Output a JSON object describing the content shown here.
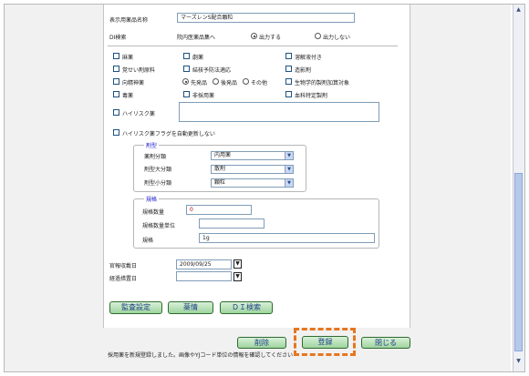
{
  "form": {
    "display_name_label": "表示用薬品名称",
    "display_name_value": "マーズレンS配合顆粒",
    "di_search_label": "DI検索",
    "di_search_desc": "院内医薬品集へ",
    "radio_output": "出力する",
    "radio_no_output": "出力しない",
    "cb_narcotic": "麻薬",
    "cb_stimulant": "覚せい剤原料",
    "cb_psychotropic": "向精神薬",
    "cb_poison": "毒薬",
    "cb_powerful": "劇薬",
    "cb_mark": "結核予防法適応",
    "radio_first": "先発品",
    "radio_generic": "後発品",
    "radio_other": "その他",
    "cb_external": "非採用薬",
    "cb_dissolve": "溶解液付き",
    "cb_contrast": "造影剤",
    "cb_bio": "生物学的製剤加算対象",
    "cb_blood": "血科特定製剤",
    "cb_high_risk": "ハイリスク薬",
    "cb_auto_flag": "ハイリスク薬フラグを自動更新しない"
  },
  "dosage": {
    "legend": "剤型",
    "class_label": "薬剤分類",
    "class_value": "内用薬",
    "major_label": "剤型大分類",
    "major_value": "散剤",
    "minor_label": "剤型小分類",
    "minor_value": "顆粒"
  },
  "spec": {
    "legend": "規格",
    "qty_label": "規格数量",
    "qty_value": "0",
    "unit_label": "規格数量単位",
    "unit_value": "",
    "spec_label": "規格",
    "spec_value": "1g"
  },
  "dates": {
    "price_date_label": "官報収載日",
    "price_date_value": "2009/09/25",
    "transition_label": "経過措置日",
    "transition_value": "",
    "cal_icon": "▼"
  },
  "buttons": {
    "audit": "監査設定",
    "drug_info": "薬情",
    "di_search": "ＤＩ検索",
    "delete": "削除",
    "register": "登録",
    "close": "閉じる"
  },
  "status": {
    "message": "採用薬を新規登録しました。画像やYJコード単位の情報を確認してください"
  },
  "icons": {
    "select_arrow": "▼",
    "scroll_up": "▲",
    "scroll_down": "▼"
  }
}
